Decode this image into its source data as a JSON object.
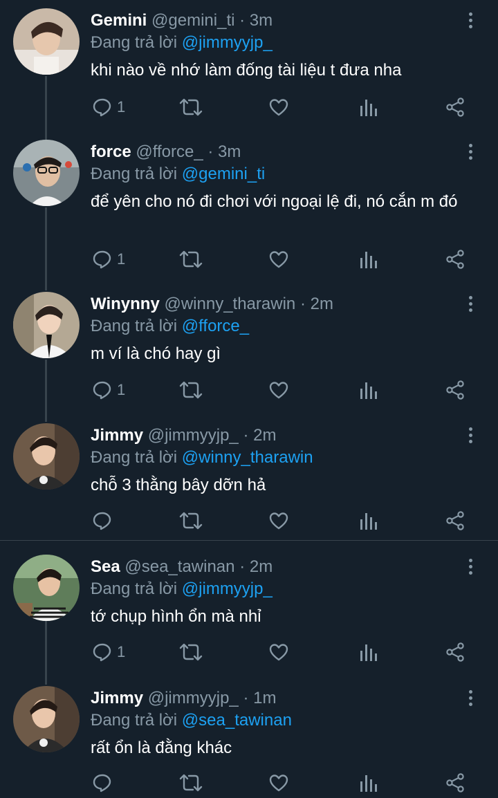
{
  "tweets": [
    {
      "name": "Gemini",
      "handle": "@gemini_ti",
      "time": "3m",
      "replying_label": "Đang trả lời",
      "replying_to": "@jimmyyjp_",
      "text": "khi nào về nhớ làm đống tài liệu t đưa nha",
      "reply_count": "1"
    },
    {
      "name": "force",
      "handle": "@fforce_",
      "time": "3m",
      "replying_label": "Đang trả lời",
      "replying_to": "@gemini_ti",
      "text": "để yên cho nó đi chơi với ngoại lệ đi, nó cắn m đó",
      "reply_count": "1"
    },
    {
      "name": "Winynny",
      "handle": "@winny_tharawin",
      "time": "2m",
      "replying_label": "Đang trả lời",
      "replying_to": "@fforce_",
      "text": "m ví là chó hay gì",
      "reply_count": "1"
    },
    {
      "name": "Jimmy",
      "handle": "@jimmyyjp_",
      "time": "2m",
      "replying_label": "Đang trả lời",
      "replying_to": "@winny_tharawin",
      "text": "chỗ 3 thằng bây dỡn hả",
      "reply_count": ""
    },
    {
      "name": "Sea",
      "handle": "@sea_tawinan",
      "time": "2m",
      "replying_label": "Đang trả lời",
      "replying_to": "@jimmyyjp_",
      "text": "tớ chụp hình ổn mà nhỉ",
      "reply_count": "1"
    },
    {
      "name": "Jimmy",
      "handle": "@jimmyyjp_",
      "time": "1m",
      "replying_label": "Đang trả lời",
      "replying_to": "@sea_tawinan",
      "text": "rất ổn là đằng khác",
      "reply_count": ""
    }
  ],
  "separator": "·",
  "icons": {
    "reply": "reply-icon",
    "retweet": "retweet-icon",
    "like": "heart-icon",
    "views": "analytics-icon",
    "share": "share-icon",
    "more": "more-vertical-icon"
  },
  "colors": {
    "background": "#15202b",
    "text": "#ffffff",
    "muted": "#8899a6",
    "mention": "#1da1f2",
    "line": "#38444d"
  }
}
